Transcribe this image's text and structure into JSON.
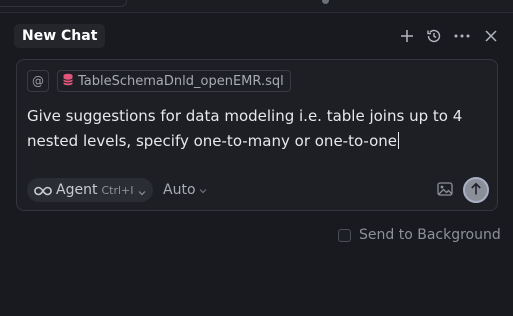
{
  "header": {
    "title": "New Chat",
    "icons": [
      "plus-icon",
      "history-icon",
      "more-icon",
      "close-icon"
    ]
  },
  "composer": {
    "mention_symbol": "@",
    "attached_file": "TableSchemaDnld_openEMR.sql",
    "prompt_text": "Give suggestions for data modeling i.e. table joins up to 4 nested levels, specify one-to-many or one-to-one",
    "mode_label": "Agent",
    "mode_shortcut": "Ctrl+I",
    "model_label": "Auto"
  },
  "footer": {
    "send_to_background_label": "Send to Background"
  },
  "colors": {
    "background": "#181a1f",
    "composer_bg": "#1d1f24",
    "file_icon": "#e0567a",
    "send_button": "#8a8f98"
  }
}
